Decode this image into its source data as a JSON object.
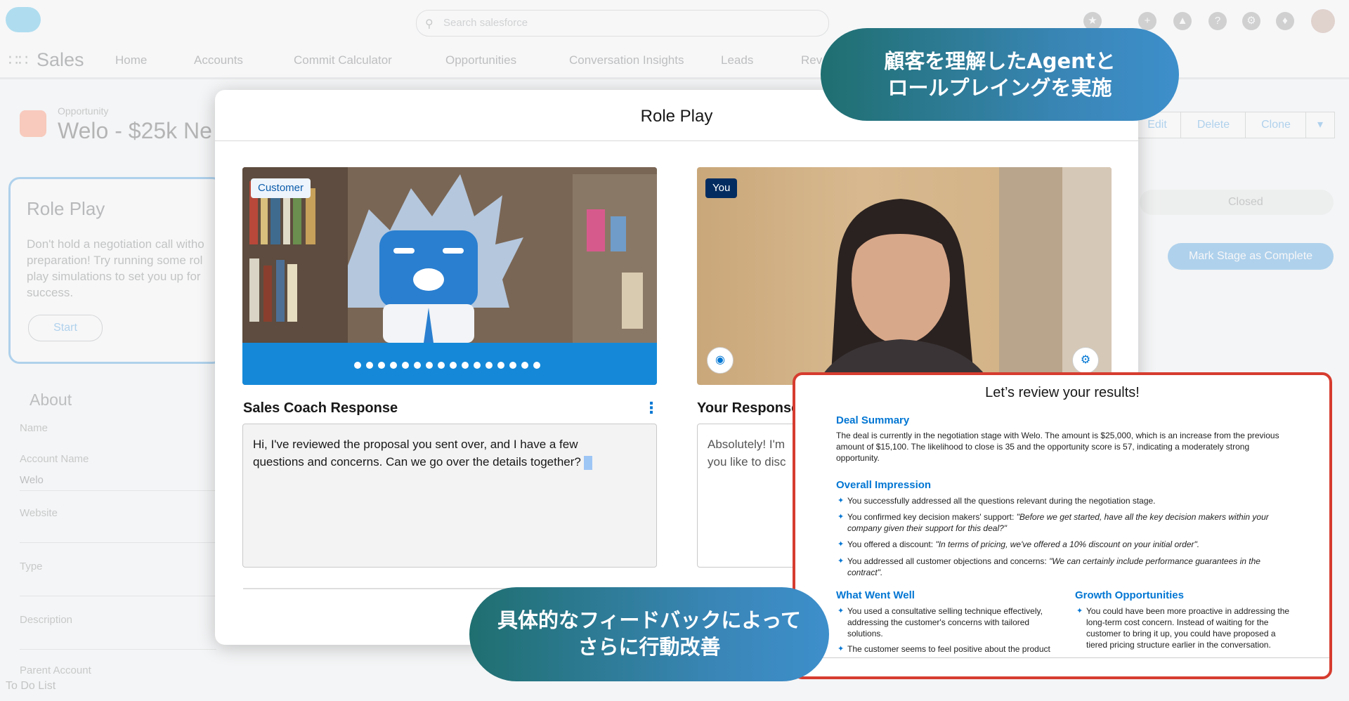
{
  "header": {
    "search_placeholder": "Search salesforce",
    "app_name": "Sales",
    "nav": [
      "Home",
      "Accounts",
      "Commit Calculator",
      "Opportunities",
      "Conversation Insights",
      "Leads",
      "Rev"
    ]
  },
  "record": {
    "type": "Opportunity",
    "title": "Welo - $25k Ne",
    "buttons": [
      "Edit",
      "Delete",
      "Clone"
    ],
    "path_stage": "Closed",
    "mark_stage_label": "Mark Stage as Complete"
  },
  "left_card": {
    "title": "Role Play",
    "description": "Don't hold a negotiation call witho preparation! Try running some rol play simulations to set you up for success.",
    "start_label": "Start"
  },
  "about": {
    "title": "About",
    "fields": [
      {
        "label": "Name",
        "value": ""
      },
      {
        "label": "Account Name",
        "value": "Welo"
      },
      {
        "label": "Website",
        "value": ""
      },
      {
        "label": "Type",
        "value": ""
      },
      {
        "label": "Description",
        "value": ""
      },
      {
        "label": "Parent Account",
        "value": ""
      }
    ],
    "todo": "To Do List"
  },
  "modal": {
    "title": "Role Play",
    "customer_badge": "Customer",
    "you_badge": "You",
    "coach_title": "Sales Coach Response",
    "coach_text_line1": "Hi, I've reviewed the proposal you sent over, and I have a few",
    "coach_text_line2": "questions and concerns. Can we go over the details together?",
    "your_title": "Your Response",
    "your_text_line1": "Absolutely! I'm",
    "your_text_line2": "you like to disc"
  },
  "results": {
    "title": "Let’s review your results!",
    "deal_summary_title": "Deal Summary",
    "deal_summary_line1": "The deal is currently in the negotiation stage with Welo. The amount is $25,000, which is an increase from the previous",
    "deal_summary_line2": "amount of $15,100. The likelihood to close is 35 and the opportunity score is 57, indicating a moderately strong",
    "deal_summary_line3": "opportunity.",
    "overall_title": "Overall Impression",
    "overall_1": "You successfully addressed all the questions relevant during the negotiation stage.",
    "overall_2a": "You confirmed key decision makers' support: ",
    "overall_2b": "\"Before we get started, have all the key decision makers within your",
    "overall_2c": "company given their support for this deal?\"",
    "overall_3a": "You offered a discount: ",
    "overall_3b": "\"In terms of pricing, we've offered a 10% discount on your initial order\".",
    "overall_4a": "You addressed all customer objections and concerns: ",
    "overall_4b": "\"We can certainly include performance guarantees in the",
    "overall_4c": "contract\".",
    "well_title": "What Went Well",
    "well_1a": "You used a consultative selling technique effectively,",
    "well_1b": "addressing the customer's concerns with tailored",
    "well_1c": "solutions.",
    "well_2": "The customer seems to feel positive about the product",
    "growth_title": "Growth Opportunities",
    "growth_1a": "You could have been more proactive in addressing the",
    "growth_1b": "long-term cost concern. Instead of waiting for the",
    "growth_1c": "customer to bring it up, you could have proposed a",
    "growth_1d": "tiered pricing structure earlier in the conversation."
  },
  "callouts": {
    "top_line1": "顧客を理解したAgentと",
    "top_line2": "ロールプレイングを実施",
    "bottom_line1": "具体的なフィードバックによって",
    "bottom_line2": "さらに行動改善"
  },
  "colors": {
    "accent": "#0176d3",
    "results_border": "#d63c2f",
    "callout_start": "#1f6f70",
    "callout_end": "#3d8fcb"
  }
}
